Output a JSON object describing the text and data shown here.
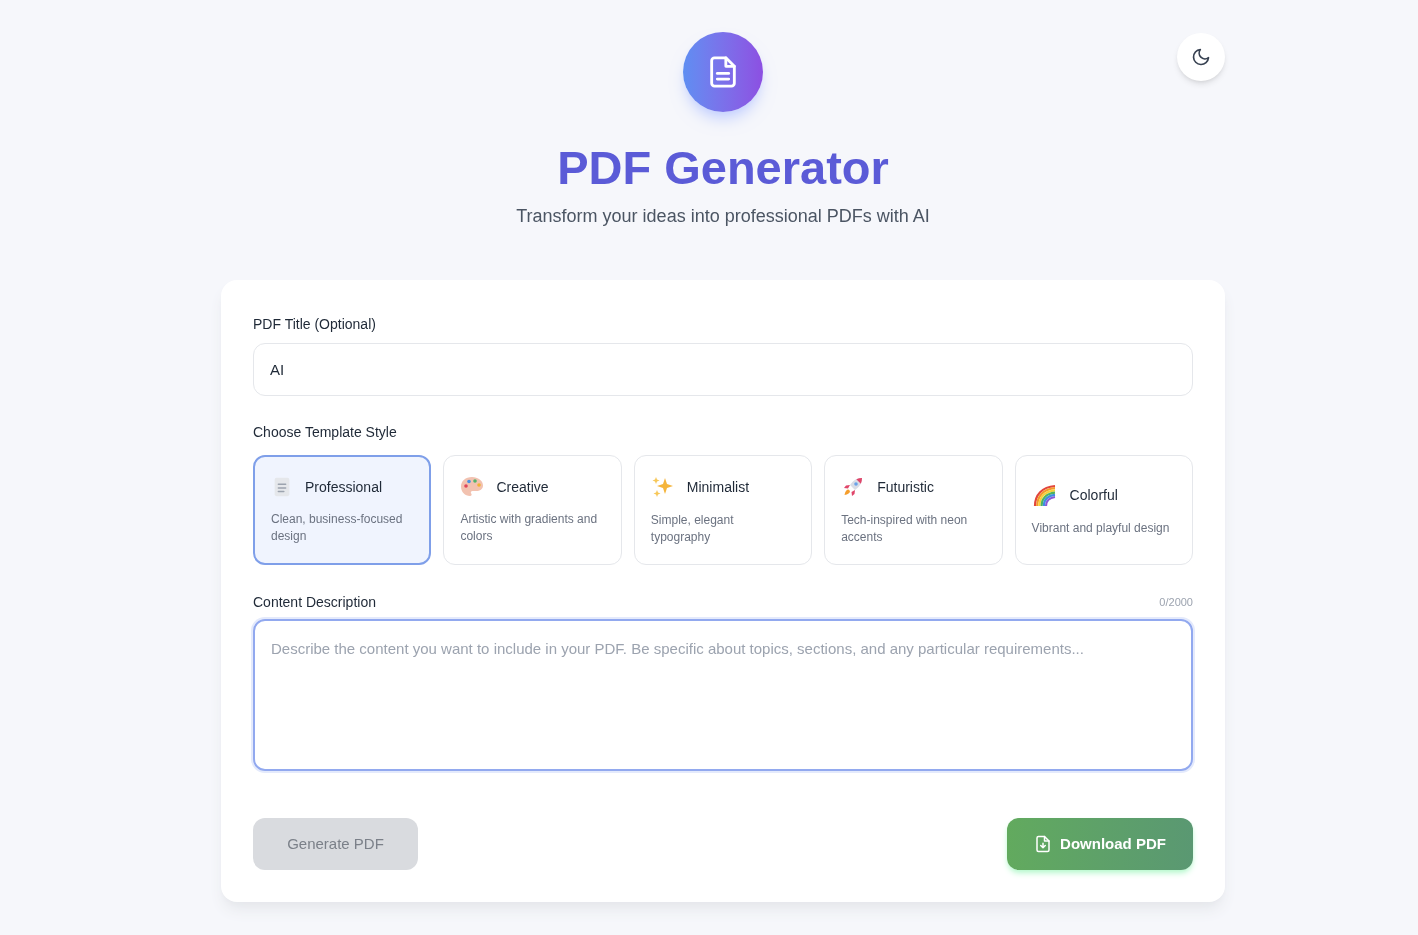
{
  "header": {
    "title": "PDF Generator",
    "subtitle": "Transform your ideas into professional PDFs with AI"
  },
  "form": {
    "title_field": {
      "label": "PDF Title (Optional)",
      "value": "AI"
    },
    "template": {
      "label": "Choose Template Style",
      "options": [
        {
          "name": "Professional",
          "description": "Clean, business-focused design",
          "selected": true
        },
        {
          "name": "Creative",
          "description": "Artistic with gradients and colors",
          "selected": false
        },
        {
          "name": "Minimalist",
          "description": "Simple, elegant typography",
          "selected": false
        },
        {
          "name": "Futuristic",
          "description": "Tech-inspired with neon accents",
          "selected": false
        },
        {
          "name": "Colorful",
          "description": "Vibrant and playful design",
          "selected": false
        }
      ]
    },
    "content": {
      "label": "Content Description",
      "counter": "0/2000",
      "placeholder": "Describe the content you want to include in your PDF. Be specific about topics, sections, and any particular requirements...",
      "focused": true
    },
    "generate_button": {
      "label": "Generate PDF",
      "disabled": true
    },
    "download_button": {
      "label": "Download PDF",
      "disabled": false
    }
  }
}
